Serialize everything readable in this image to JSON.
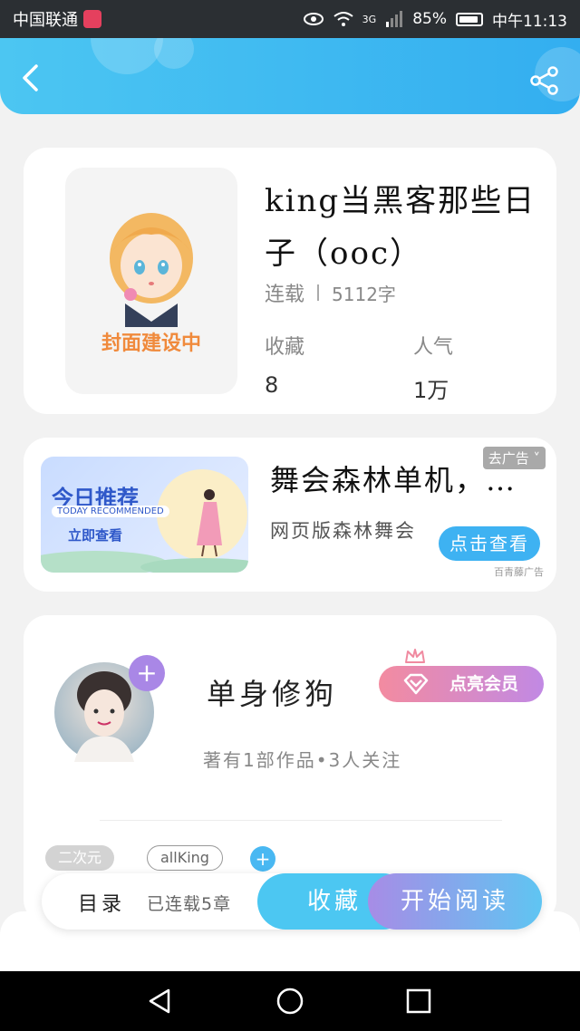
{
  "status_bar": {
    "carrier": "中国联通",
    "network": "3G",
    "battery": "85%",
    "time": "中午11:13"
  },
  "header": {
    "back_icon": "chevron-left-icon",
    "share_icon": "share-icon"
  },
  "book": {
    "cover_caption": "封面建设中",
    "title": "king当黑客那些日子（ooc）",
    "status": "连载",
    "word_count": "5112字",
    "favorites_label": "收藏",
    "favorites_value": "8",
    "popularity_label": "人气",
    "popularity_value": "1万"
  },
  "ad": {
    "banner_title": "今日推荐",
    "banner_subtitle": "TODAY RECOMMENDED",
    "banner_button": "立即查看",
    "title": "舞会森林单机，…",
    "remove_label": "去广告",
    "description": "网页版森林舞会",
    "view_button": "点击查看",
    "source": "百青藤广告"
  },
  "author": {
    "name": "单身修狗",
    "info": "著有1部作品•3人关注",
    "vip_button": "点亮会员",
    "tags": [
      "二次元",
      "allKing"
    ]
  },
  "bottom_bar": {
    "toc_label": "目录",
    "serial_status": "已连载5章",
    "collect_button": "收藏",
    "read_button": "开始阅读"
  },
  "colors": {
    "header_gradient_start": "#4cc6f2",
    "header_gradient_end": "#33aef0",
    "vip_gradient_start": "#f38ba0",
    "vip_gradient_end": "#c189e4",
    "accent_blue": "#4cc7f2",
    "avatar_add": "#a987e6"
  }
}
